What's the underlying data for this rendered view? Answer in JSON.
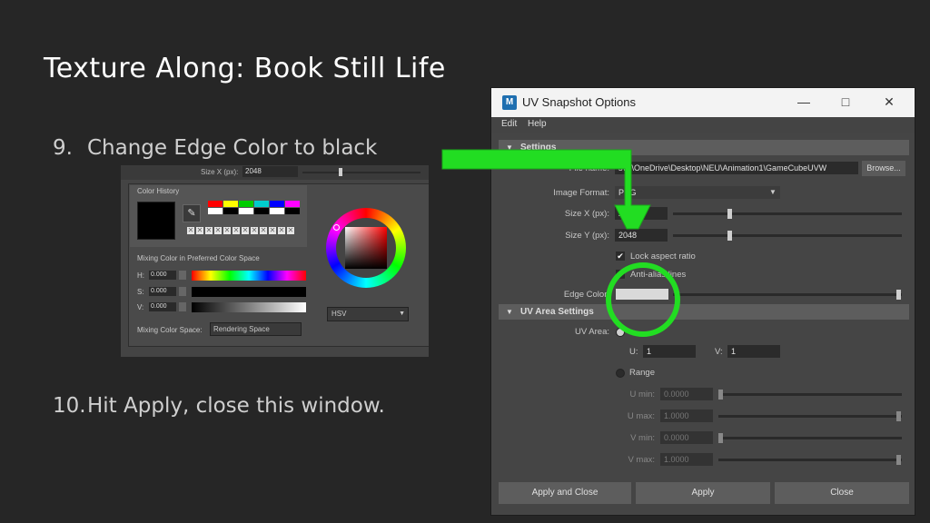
{
  "slide": {
    "title": "Texture Along: Book Still Life",
    "step9_num": "9.",
    "step9_text": "Change Edge Color to black",
    "step10_num": "10.",
    "step10_text": "Hit Apply, close this window."
  },
  "color_chooser": {
    "size_x_label": "Size X (px):",
    "size_x_value": "2048",
    "history_label": "Color History",
    "mixing_label": "Mixing Color in Preferred Color Space",
    "h_label": "H:",
    "h_value": "0.000",
    "s_label": "S:",
    "s_value": "0.000",
    "v_label": "V:",
    "v_value": "0.000",
    "space_label": "Mixing Color Space:",
    "space_value": "Rendering Space",
    "wheel_mode": "HSV",
    "history_colors": [
      "#ff0000",
      "#ffff00",
      "#00cc00",
      "#00cccc",
      "#0000ff",
      "#ff00ff",
      "#ffffff",
      "#000000",
      "#ffffff",
      "#000000",
      "#ffffff",
      "#000000"
    ]
  },
  "uv_window": {
    "title": "UV Snapshot Options",
    "menu_edit": "Edit",
    "menu_help": "Help",
    "section_settings": "Settings",
    "filename_label": "File name:",
    "filename_value": "s\\...\\OneDrive\\Desktop\\NEU\\Animation1\\GameCubeUVW",
    "browse_label": "Browse...",
    "image_format_label": "Image Format:",
    "image_format_value": "PNG",
    "size_x_label": "Size X (px):",
    "size_x_value": "2048",
    "size_y_label": "Size Y (px):",
    "size_y_value": "2048",
    "lock_aspect_label": "Lock aspect ratio",
    "anti_alias_label": "Anti-alias lines",
    "edge_color_label": "Edge Color:",
    "edge_color_value": "#d9d9d9",
    "section_uv_area": "UV Area Settings",
    "uv_area_label": "UV Area:",
    "u_label": "U:",
    "u_value": "1",
    "v_label": "V:",
    "v_value": "1",
    "range_label": "Range",
    "u_min_label": "U min:",
    "u_min_value": "0.0000",
    "u_max_label": "U max:",
    "u_max_value": "1.0000",
    "v_min_label": "V min:",
    "v_min_value": "0.0000",
    "v_max_label": "V max:",
    "v_max_value": "1.0000",
    "apply_close_label": "Apply and Close",
    "apply_label": "Apply",
    "close_label": "Close"
  },
  "annotation": {
    "arrow_color": "#22dd22",
    "circle_color": "#22dd22"
  }
}
